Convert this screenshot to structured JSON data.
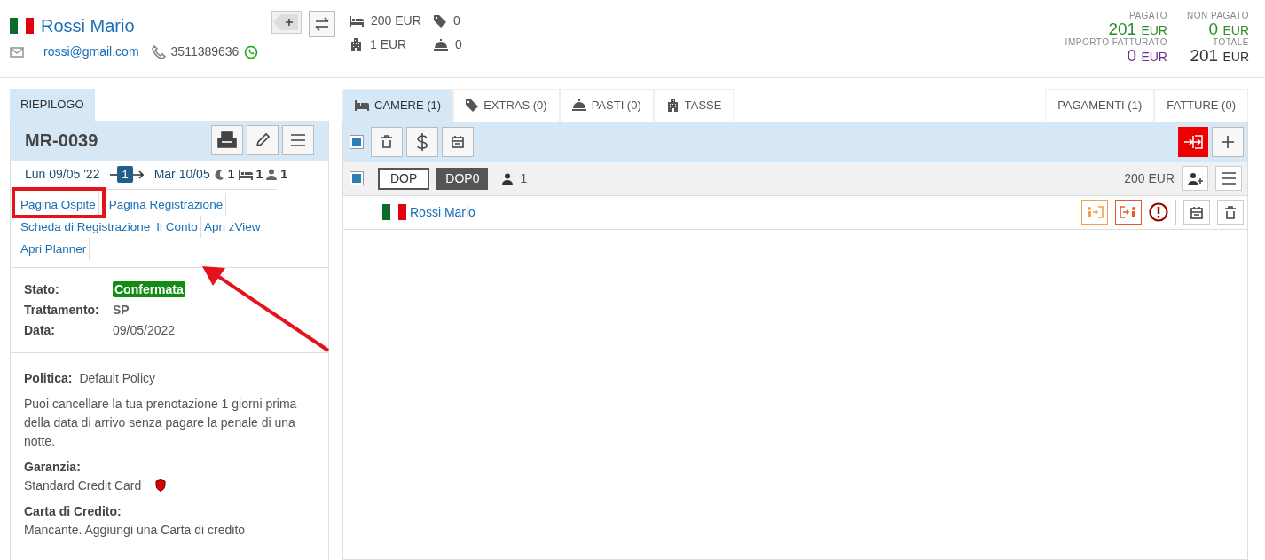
{
  "guest": {
    "name": "Rossi Mario",
    "email": "rossi@gmail.com",
    "phone": "3511389636"
  },
  "counters": [
    {
      "kind": "rooms",
      "value": "200 EUR"
    },
    {
      "kind": "extras",
      "value": "0"
    },
    {
      "kind": "taxes",
      "value": "1 EUR"
    },
    {
      "kind": "meals",
      "value": "0"
    }
  ],
  "totals": [
    {
      "label": "PAGATO",
      "amount": "201",
      "currency": "EUR",
      "color": "#2e8b2e"
    },
    {
      "label": "NON PAGATO",
      "amount": "0",
      "currency": "EUR",
      "color": "#2e8b2e"
    },
    {
      "label": "IMPORTO FATTURATO",
      "amount": "0",
      "currency": "EUR",
      "color": "#6a2c91"
    },
    {
      "label": "TOTALE",
      "amount": "201",
      "currency": "EUR",
      "color": "#333333"
    }
  ],
  "summary": {
    "tab": "RIEPILOGO",
    "code": "MR-0039",
    "arrival": "Lun 09/05 '22",
    "nights_badge": "1",
    "departure": "Mar 10/05",
    "nights": "1",
    "rooms": "1",
    "guests": "1",
    "links": [
      "Pagina Ospite",
      "Pagina Registrazione",
      "Scheda di Registrazione",
      "Il Conto",
      "Apri zView",
      "Apri Planner"
    ],
    "details": [
      {
        "label": "Stato:",
        "value": "Confermata",
        "kind": "status"
      },
      {
        "label": "Trattamento:",
        "value": "SP",
        "kind": "bold"
      },
      {
        "label": "Data:",
        "value": "09/05/2022",
        "kind": "plain"
      }
    ],
    "policy_label": "Politica:",
    "policy_name": "Default Policy",
    "policy_text": "Puoi cancellare la tua prenotazione 1 giorni prima della data di arrivo senza pagare la penale di una notte.",
    "guarantee_label": "Garanzia:",
    "guarantee_value": "Standard Credit Card",
    "card_label": "Carta di Credito:",
    "card_status": "Mancante.",
    "card_link": "Aggiungi una Carta di credito"
  },
  "tabs": [
    {
      "label": "CAMERE (1)",
      "kind": "rooms",
      "selected": true
    },
    {
      "label": "EXTRAS (0)",
      "kind": "extras",
      "selected": false
    },
    {
      "label": "PASTI (0)",
      "kind": "meals",
      "selected": false
    },
    {
      "label": "TASSE",
      "kind": "taxes",
      "selected": false
    }
  ],
  "tabs_right": [
    {
      "label": "PAGAMENTI (1)",
      "selected": false
    },
    {
      "label": "FATTURE (0)",
      "selected": false
    }
  ],
  "toolbar": {
    "checked": true
  },
  "room": {
    "checked": true,
    "code": "DOP",
    "type": "DOP0",
    "guests": "1",
    "price": "200 EUR",
    "guest_name": "Rossi Mario"
  }
}
